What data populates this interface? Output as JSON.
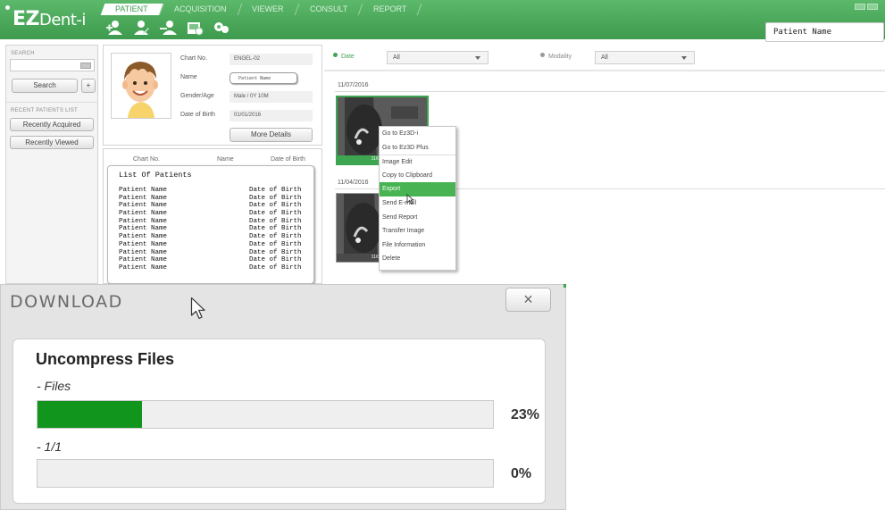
{
  "app": {
    "logo_prefix": "EZ",
    "logo_suffix": "Dent-i"
  },
  "tabs": [
    "PATIENT",
    "ACQUISITION",
    "VIEWER",
    "CONSULT",
    "REPORT"
  ],
  "active_tab": "PATIENT",
  "top_search": {
    "value": "Patient Name"
  },
  "sidebar": {
    "search_label": "SEARCH",
    "search_button": "Search",
    "add_button": "+",
    "recent_label": "RECENT PATIENTS LIST",
    "recent_acquired": "Recently Acquired",
    "recent_viewed": "Recently Viewed"
  },
  "patient": {
    "chart_label": "Chart No.",
    "chart_value": "ENGEL-02",
    "name_label": "Name",
    "name_value": "Patient Name",
    "gender_label": "Gender/Age",
    "gender_value": "Male / 0Y 10M",
    "dob_label": "Date of Birth",
    "dob_value": "01/01/2016",
    "more_details": "More Details"
  },
  "list": {
    "col_chart": "Chart No.",
    "col_name": "Name",
    "col_dob": "Date of Birth",
    "title": "List Of Patients",
    "rows": [
      {
        "name": "Patient Name",
        "dob": "Date of Birth"
      },
      {
        "name": "Patient Name",
        "dob": "Date of Birth"
      },
      {
        "name": "Patient Name",
        "dob": "Date of Birth"
      },
      {
        "name": "Patient Name",
        "dob": "Date of Birth"
      },
      {
        "name": "Patient Name",
        "dob": "Date of Birth"
      },
      {
        "name": "Patient Name",
        "dob": "Date of Birth"
      },
      {
        "name": "Patient Name",
        "dob": "Date of Birth"
      },
      {
        "name": "Patient Name",
        "dob": "Date of Birth"
      },
      {
        "name": "Patient Name",
        "dob": "Date of Birth"
      },
      {
        "name": "Patient Name",
        "dob": "Date of Birth"
      },
      {
        "name": "Patient Name",
        "dob": "Date of Birth"
      }
    ]
  },
  "filters": {
    "date_label": "Date",
    "date_value": "All",
    "modality_label": "Modality",
    "modality_value": "All"
  },
  "studies": [
    {
      "date": "11/07/2016",
      "thumb_caption": "11/07/2016"
    },
    {
      "date": "11/04/2016",
      "thumb_caption": "11/04/2016"
    }
  ],
  "context_menu": {
    "items": [
      "Go to Ez3D-i",
      "Go to Ez3D Plus",
      "Image Edit",
      "Copy to Clipboard",
      "Export",
      "Send E-mail",
      "Send Report",
      "Transfer Image",
      "File Information",
      "Delete"
    ],
    "highlighted": "Export"
  },
  "download": {
    "title": "DOWNLOAD",
    "close": "×",
    "heading": "Uncompress Files",
    "files_label": "- Files",
    "files_progress": 23,
    "files_pct": "23%",
    "current_label": "- 1/1",
    "current_progress": 0,
    "current_pct": "0%"
  },
  "colors": {
    "brand_green": "#3e9b4e",
    "progress_green": "#11951d",
    "highlight_green": "#47b352"
  }
}
